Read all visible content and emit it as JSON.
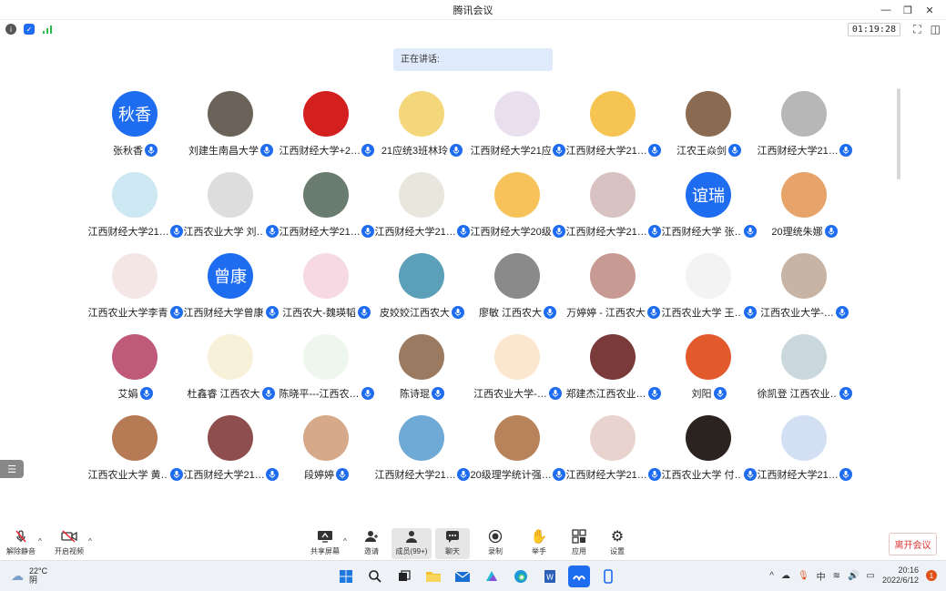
{
  "window": {
    "title": "腾讯会议"
  },
  "statusbar": {
    "timer": "01:19:28"
  },
  "speaking": {
    "label": "正在讲话:"
  },
  "colors": {
    "accent": "#1e6cf0",
    "leave": "#d33333"
  },
  "participants": [
    [
      {
        "name": "张秋香",
        "avatar_text": "秋香",
        "avatar_color": "#1e6cf0"
      },
      {
        "name": "刘建生南昌大学",
        "avatar_text": "",
        "avatar_color": "#6b6259"
      },
      {
        "name": "江西财经大学+2…",
        "avatar_text": "",
        "avatar_color": "#d41f1f"
      },
      {
        "name": "21应统3班林玲",
        "avatar_text": "",
        "avatar_color": "#f3d77a"
      },
      {
        "name": "江西财经大学21应…",
        "avatar_text": "",
        "avatar_color": "#e9e0ef"
      },
      {
        "name": "江西财经大学21…",
        "avatar_text": "",
        "avatar_color": "#f5c452"
      },
      {
        "name": "江农王焱剑",
        "avatar_text": "",
        "avatar_color": "#8a6a50"
      },
      {
        "name": "江西财经大学21…",
        "avatar_text": "",
        "avatar_color": "#b7b7b7"
      }
    ],
    [
      {
        "name": "江西财经大学21…",
        "avatar_text": "",
        "avatar_color": "#cde8f2"
      },
      {
        "name": "江西农业大学 刘…",
        "avatar_text": "",
        "avatar_color": "#dddddd"
      },
      {
        "name": "江西财经大学21…",
        "avatar_text": "",
        "avatar_color": "#6a7c70"
      },
      {
        "name": "江西财经大学21…",
        "avatar_text": "",
        "avatar_color": "#e9e6dd"
      },
      {
        "name": "江西财经大学20级…",
        "avatar_text": "",
        "avatar_color": "#f7c25a"
      },
      {
        "name": "江西财经大学21…",
        "avatar_text": "",
        "avatar_color": "#d9c2c2"
      },
      {
        "name": "江西财经大学 张…",
        "avatar_text": "谊瑞",
        "avatar_color": "#1e6cf0"
      },
      {
        "name": "20理统朱娜",
        "avatar_text": "",
        "avatar_color": "#e7a46a"
      }
    ],
    [
      {
        "name": "江西农业大学李青",
        "avatar_text": "",
        "avatar_color": "#f5e6e6"
      },
      {
        "name": "江西财经大学曾康",
        "avatar_text": "曾康",
        "avatar_color": "#1e6cf0"
      },
      {
        "name": "江西农大-魏瑛韬",
        "avatar_text": "",
        "avatar_color": "#f6d9e3"
      },
      {
        "name": "皮姣姣江西农大",
        "avatar_text": "",
        "avatar_color": "#5c9fb9"
      },
      {
        "name": "廖敏 江西农大",
        "avatar_text": "",
        "avatar_color": "#8a8a8a"
      },
      {
        "name": "万婷婷 - 江西农大",
        "avatar_text": "",
        "avatar_color": "#c79b93"
      },
      {
        "name": "江西农业大学 王…",
        "avatar_text": "",
        "avatar_color": "#f3f3f3"
      },
      {
        "name": "江西农业大学-…",
        "avatar_text": "",
        "avatar_color": "#c8b4a4"
      }
    ],
    [
      {
        "name": "艾娟",
        "avatar_text": "",
        "avatar_color": "#c05a7a"
      },
      {
        "name": "杜鑫睿 江西农大",
        "avatar_text": "",
        "avatar_color": "#f8f0d9"
      },
      {
        "name": "陈晓平---江西农…",
        "avatar_text": "",
        "avatar_color": "#eef7ee"
      },
      {
        "name": "陈诗琨",
        "avatar_text": "",
        "avatar_color": "#9a7b62"
      },
      {
        "name": "江西农业大学-…",
        "avatar_text": "",
        "avatar_color": "#fbe7cf"
      },
      {
        "name": "郑建杰江西农业…",
        "avatar_text": "",
        "avatar_color": "#7a3a3a"
      },
      {
        "name": "刘阳",
        "avatar_text": "",
        "avatar_color": "#e25a2c"
      },
      {
        "name": "徐凯登 江西农业…",
        "avatar_text": "",
        "avatar_color": "#cad8de"
      }
    ],
    [
      {
        "name": "江西农业大学 黄…",
        "avatar_text": "",
        "avatar_color": "#b67a55"
      },
      {
        "name": "江西财经大学21…",
        "avatar_text": "",
        "avatar_color": "#8f4e4e"
      },
      {
        "name": "段婷婷",
        "avatar_text": "",
        "avatar_color": "#d6a98a"
      },
      {
        "name": "江西财经大学21…",
        "avatar_text": "",
        "avatar_color": "#6fa9d6"
      },
      {
        "name": "20级理学统计强…",
        "avatar_text": "",
        "avatar_color": "#b8825a"
      },
      {
        "name": "江西财经大学21…",
        "avatar_text": "",
        "avatar_color": "#e9d3cf"
      },
      {
        "name": "江西农业大学 付…",
        "avatar_text": "",
        "avatar_color": "#2a2320"
      },
      {
        "name": "江西财经大学21…",
        "avatar_text": "",
        "avatar_color": "#d3e0f3"
      }
    ]
  ],
  "toolbar": {
    "mute": "解除静音",
    "video": "开启视频",
    "share": "共享屏幕",
    "invite": "邀请",
    "members": "成员(99+)",
    "chat": "聊天",
    "record": "录制",
    "raise_hand": "举手",
    "apps": "应用",
    "settings": "设置",
    "leave": "离开会议"
  },
  "taskbar": {
    "temperature": "22°C",
    "weather": "阴",
    "input_method": "中",
    "time": "20:16",
    "date": "2022/6/12",
    "notifications": "1"
  }
}
